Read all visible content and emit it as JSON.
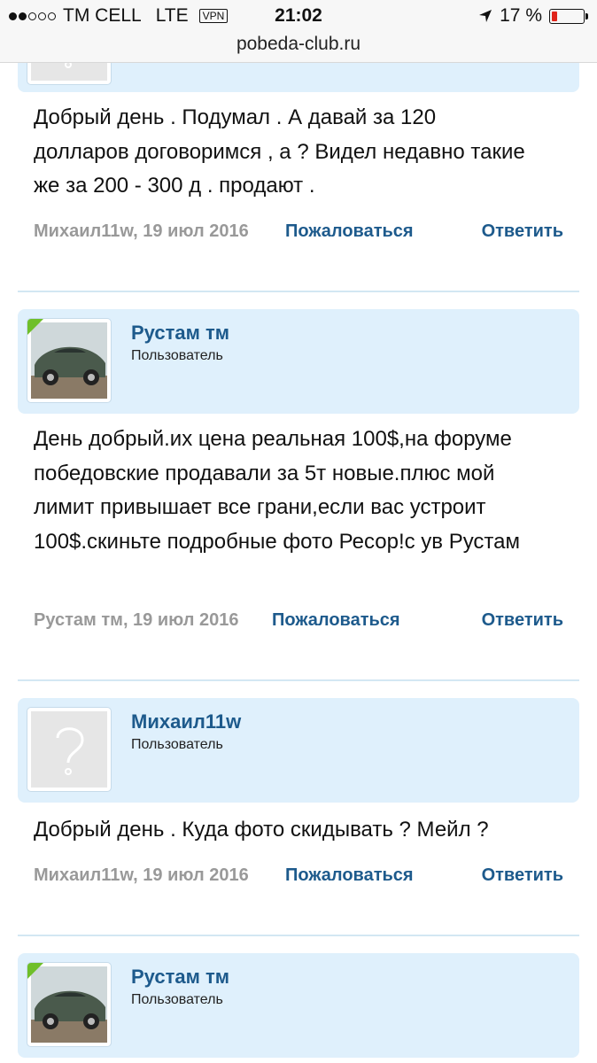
{
  "status": {
    "carrier": "TM CELL",
    "network": "LTE",
    "vpn": "VPN",
    "time": "21:02",
    "battery_text": "17 %",
    "battery_level": 0.17,
    "location_icon": "location-arrow-icon"
  },
  "browser": {
    "url": "pobeda-club.ru"
  },
  "posts": [
    {
      "message": "Добрый день . Подумал . А давай за 120 долларов договоримся , а ? Видел недавно такие же за 200 - 300 д . продают .",
      "meta": "Михаил11w, 19 июл 2016",
      "report": "Пожаловаться",
      "reply": "Ответить"
    },
    {
      "user": "Рустам тм",
      "role": "Пользователь",
      "message": "День добрый.их цена реальная 100$,на форуме победовские продавали за 5т новые.плюс мой лимит привышает все грани,если вас устроит 100$.скиньте подробные фото Ресор!с ув Рустам",
      "meta": "Рустам тм, 19 июл 2016",
      "report": "Пожаловаться",
      "reply": "Ответить"
    },
    {
      "user": "Михаил11w",
      "role": "Пользователь",
      "message": "Добрый день . Куда фото скидывать ? Мейл ?",
      "meta": "Михаил11w, 19 июл 2016",
      "report": "Пожаловаться",
      "reply": "Ответить"
    },
    {
      "user": "Рустам тм",
      "role": "Пользователь"
    }
  ],
  "colors": {
    "user_bg": "#dff0fc",
    "link": "#1d5a8c",
    "meta_gray": "#999999",
    "online_badge": "#6fbf2a"
  }
}
